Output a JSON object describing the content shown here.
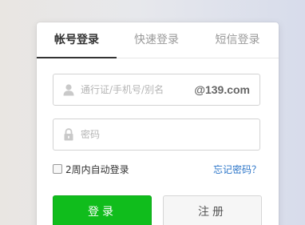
{
  "tabs": [
    {
      "label": "帐号登录",
      "active": true
    },
    {
      "label": "快速登录",
      "active": false
    },
    {
      "label": "短信登录",
      "active": false
    }
  ],
  "account_field": {
    "placeholder": "通行证/手机号/别名",
    "value": "",
    "icon": "user-icon",
    "suffix": "@139.com"
  },
  "password_field": {
    "placeholder": "密码",
    "value": "",
    "icon": "lock-icon"
  },
  "remember": {
    "label": "2周内自动登录",
    "checked": false
  },
  "forgot_link": "忘记密码？",
  "buttons": {
    "login": "登录",
    "register": "注册"
  },
  "colors": {
    "login_button": "#10bd1c",
    "link": "#2a74c8",
    "active_tab": "#333333",
    "inactive_tab": "#9a9a9a"
  }
}
